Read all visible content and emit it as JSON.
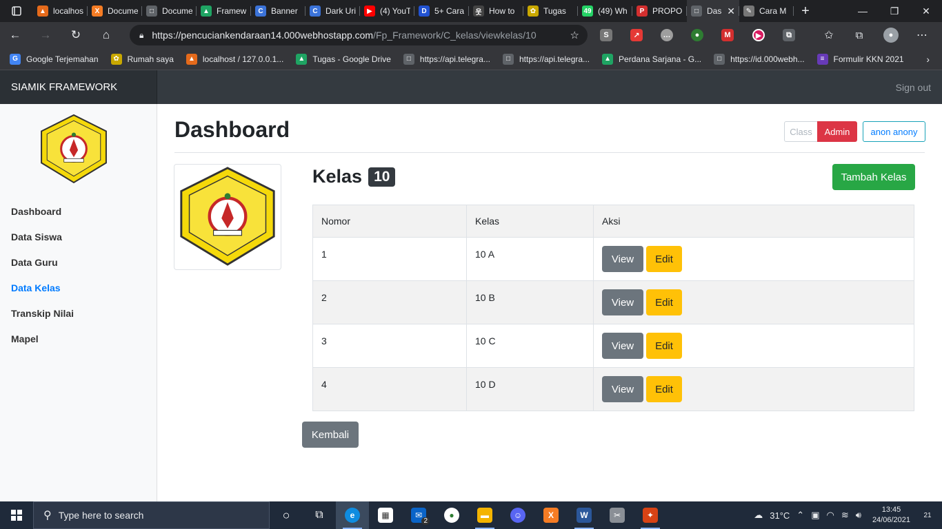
{
  "browser": {
    "tabs": [
      {
        "label": "localhos",
        "icon_color": "#e56a1b",
        "glyph": "▲"
      },
      {
        "label": "Docume",
        "icon_color": "#f57c24",
        "glyph": "X"
      },
      {
        "label": "Docume",
        "icon_color": "#5f6368",
        "glyph": "□"
      },
      {
        "label": "Framew",
        "icon_color": "#1fa463",
        "glyph": "▲"
      },
      {
        "label": "Banner",
        "icon_color": "#3b73d9",
        "glyph": "C"
      },
      {
        "label": "Dark Uri",
        "icon_color": "#3b73d9",
        "glyph": "C"
      },
      {
        "label": "(4) YouT",
        "icon_color": "#ff0000",
        "glyph": "▶"
      },
      {
        "label": "5+ Cara",
        "icon_color": "#2152d1",
        "glyph": "D"
      },
      {
        "label": "How to",
        "icon_color": "#444444",
        "glyph": "웃"
      },
      {
        "label": "Tugas",
        "icon_color": "#c9a800",
        "glyph": "✿"
      },
      {
        "label": "(49) Wh",
        "icon_color": "#25d366",
        "glyph": "49"
      },
      {
        "label": "PROPO",
        "icon_color": "#d32f2f",
        "glyph": "P"
      },
      {
        "label": "Das",
        "icon_color": "#5f6368",
        "glyph": "□",
        "active": true
      },
      {
        "label": "Cara M",
        "icon_color": "#777777",
        "glyph": "✎"
      }
    ],
    "url_host": "https://pencuciankendaraan14.000webhostapp.com",
    "url_path": "/Fp_Framework/C_kelas/viewkelas/10",
    "bookmarks": [
      {
        "label": "Google Terjemahan",
        "icon_color": "#4285f4",
        "glyph": "G"
      },
      {
        "label": "Rumah saya",
        "icon_color": "#c9a800",
        "glyph": "✿"
      },
      {
        "label": "localhost / 127.0.0.1...",
        "icon_color": "#e56a1b",
        "glyph": "▲"
      },
      {
        "label": "Tugas - Google Drive",
        "icon_color": "#1fa463",
        "glyph": "▲"
      },
      {
        "label": "https://api.telegra...",
        "icon_color": "#5f6368",
        "glyph": "□"
      },
      {
        "label": "https://api.telegra...",
        "icon_color": "#5f6368",
        "glyph": "□"
      },
      {
        "label": "Perdana Sarjana - G...",
        "icon_color": "#1fa463",
        "glyph": "▲"
      },
      {
        "label": "https://id.000webh...",
        "icon_color": "#5f6368",
        "glyph": "□"
      },
      {
        "label": "Formulir KKN 2021",
        "icon_color": "#673ab7",
        "glyph": "≡"
      }
    ]
  },
  "app": {
    "brand": "SIAMIK FRAMEWORK",
    "signout": "Sign out"
  },
  "sidebar": {
    "items": [
      {
        "label": "Dashboard",
        "active": false
      },
      {
        "label": "Data Siswa",
        "active": false
      },
      {
        "label": "Data Guru",
        "active": false
      },
      {
        "label": "Data Kelas",
        "active": true
      },
      {
        "label": "Transkip Nilai",
        "active": false
      },
      {
        "label": "Mapel",
        "active": false
      }
    ]
  },
  "main": {
    "title": "Dashboard",
    "role_class": "Class",
    "role_admin": "Admin",
    "user": "anon anony",
    "kelas_label": "Kelas",
    "kelas_badge": "10",
    "add_button": "Tambah Kelas",
    "back_button": "Kembali",
    "table": {
      "headers": [
        "Nomor",
        "Kelas",
        "Aksi"
      ],
      "view_label": "View",
      "edit_label": "Edit",
      "rows": [
        {
          "nomor": "1",
          "kelas": "10 A"
        },
        {
          "nomor": "2",
          "kelas": "10 B"
        },
        {
          "nomor": "3",
          "kelas": "10 C"
        },
        {
          "nomor": "4",
          "kelas": "10 D"
        }
      ]
    }
  },
  "taskbar": {
    "search_placeholder": "Type here to search",
    "mail_badge": "2",
    "weather": "31°C",
    "time": "13:45",
    "date": "24/06/2021",
    "notifications": "21"
  },
  "colors": {
    "admin": "#dc3545",
    "add": "#28a745",
    "edit": "#ffc107",
    "view": "#6c757d",
    "active_link": "#007bff"
  }
}
